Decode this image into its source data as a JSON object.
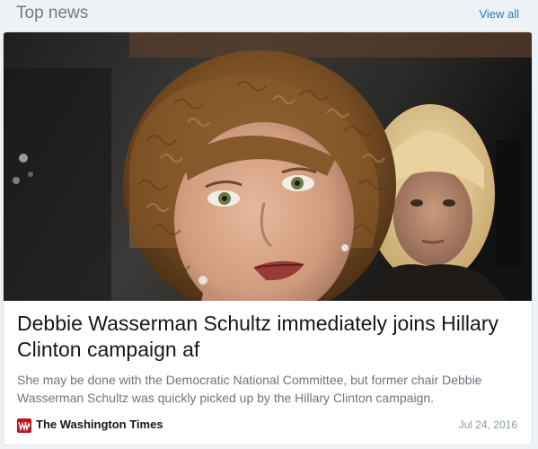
{
  "header": {
    "title": "Top news",
    "view_all_label": "View all"
  },
  "article": {
    "headline": "Debbie Wasserman Schultz immediately joins Hillary Clinton campaign af",
    "summary": "She may be done with the Democratic National Committee, but former chair Debbie Wasserman Schultz was quickly picked up by the Hillary Clinton campaign.",
    "source": "The Washington Times",
    "date": "Jul 24, 2016",
    "image_icon": "news-photo"
  },
  "colors": {
    "accent": "#2b7bb9",
    "source_logo": "#b8161d",
    "background": "#eef2f5"
  }
}
